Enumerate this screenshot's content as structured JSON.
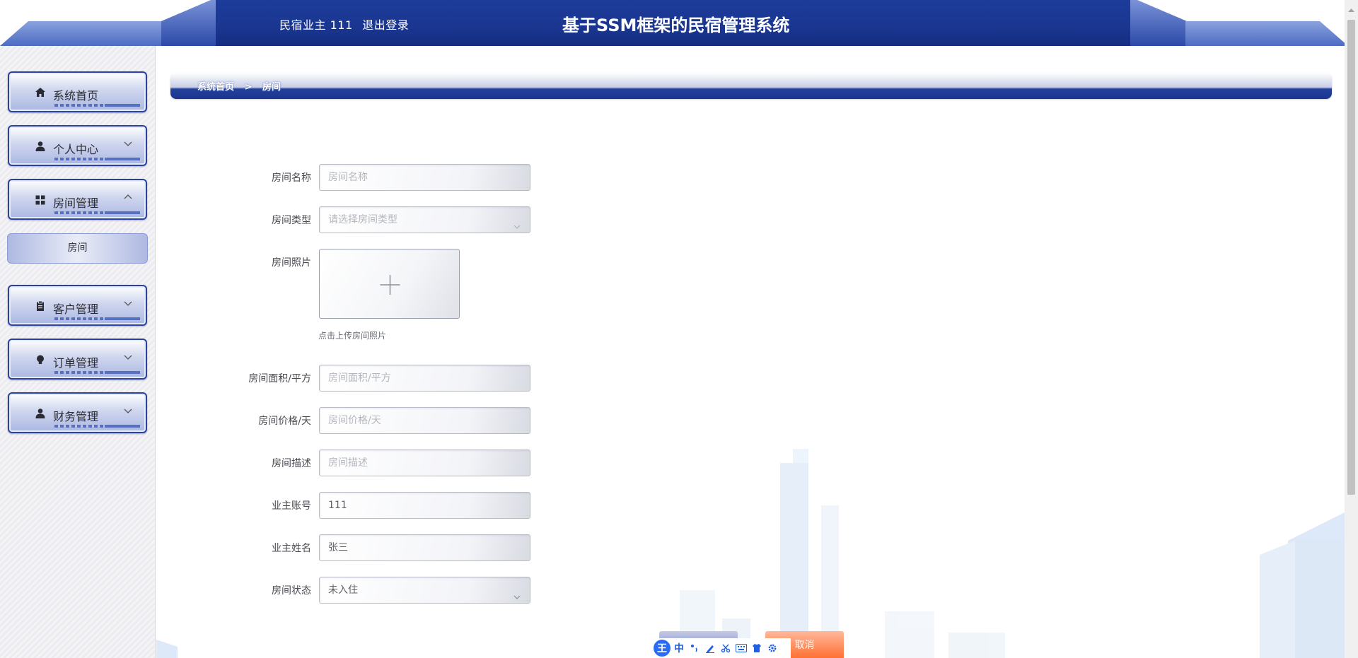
{
  "header": {
    "user_label": "民宿业主 111",
    "logout_label": "退出登录",
    "title": "基于SSM框架的民宿管理系统"
  },
  "sidebar": {
    "items": [
      {
        "label": "系统首页",
        "icon": "home-icon",
        "has_chevron": false
      },
      {
        "label": "个人中心",
        "icon": "person-icon",
        "has_chevron": true
      },
      {
        "label": "房间管理",
        "icon": "grid-icon",
        "has_chevron": true,
        "expanded": true
      },
      {
        "label": "客户管理",
        "icon": "clipboard-icon",
        "has_chevron": true
      },
      {
        "label": "订单管理",
        "icon": "bulb-icon",
        "has_chevron": true
      },
      {
        "label": "财务管理",
        "icon": "person-icon",
        "has_chevron": true
      }
    ],
    "submenu": {
      "label": "房间"
    }
  },
  "breadcrumb": {
    "home": "系统首页",
    "separator": ">",
    "current": "房间"
  },
  "form": {
    "room_name": {
      "label": "房间名称",
      "placeholder": "房间名称",
      "value": ""
    },
    "room_type": {
      "label": "房间类型",
      "placeholder": "请选择房间类型",
      "value": ""
    },
    "room_photo": {
      "label": "房间照片",
      "hint": "点击上传房间照片"
    },
    "room_area": {
      "label": "房间面积/平方",
      "placeholder": "房间面积/平方",
      "value": ""
    },
    "room_price": {
      "label": "房间价格/天",
      "placeholder": "房间价格/天",
      "value": ""
    },
    "room_desc": {
      "label": "房间描述",
      "placeholder": "房间描述",
      "value": ""
    },
    "owner_account": {
      "label": "业主账号",
      "value": "111"
    },
    "owner_name": {
      "label": "业主姓名",
      "value": "张三"
    },
    "room_status": {
      "label": "房间状态",
      "value": "未入住"
    }
  },
  "buttons": {
    "cancel_label": "取消"
  },
  "ime": {
    "logo": "王",
    "mode": "中"
  },
  "colors": {
    "header_blue": "#1a3690",
    "accent_orange": "#ff6d2f"
  }
}
